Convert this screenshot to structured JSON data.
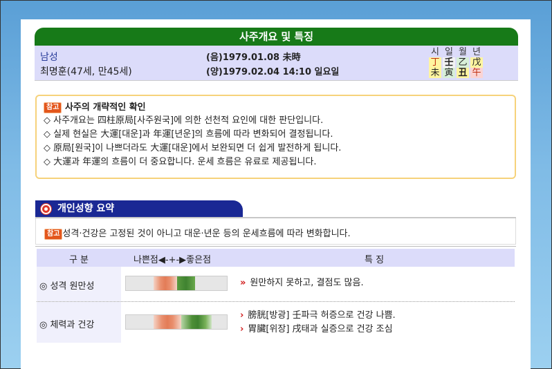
{
  "header": {
    "title": "사주개요 및 특징",
    "gender": "남성",
    "person": "최명훈(47세, 만45세)",
    "lunar_date": "(음)1979.01.08 未時",
    "solar_date": "(양)1979.02.04 14:10 일요일"
  },
  "pillars": [
    {
      "head": "시",
      "stem": "丁",
      "branch": "未",
      "stem_bg": "#fff5a0",
      "branch_bg": "#fff5a0"
    },
    {
      "head": "일",
      "stem": "壬",
      "branch": "寅",
      "stem_bg": "#f2f2f2",
      "branch_bg": "#d8f0d8"
    },
    {
      "head": "월",
      "stem": "乙",
      "branch": "丑",
      "stem_bg": "#d8f0d8",
      "branch_bg": "#fff5a0"
    },
    {
      "head": "년",
      "stem": "戊",
      "branch": "午",
      "stem_bg": "#fff5a0",
      "branch_bg": "#fad4d4"
    }
  ],
  "notice": {
    "badge": "참고",
    "heading": "사주의 개략적인 확인",
    "lines": [
      "◇ 사주개요는 四柱原局[사주원국]에 의한 선천적 요인에 대한 판단입니다.",
      "◇ 실제 현실은 大運[대운]과 年運[년운]의 흐름에 따라 변화되어 결정됩니다.",
      "◇ 原局[원국]이 나쁘더라도 大運[대운]에서 보완되면 더 쉽게 발전하게 됩니다.",
      "◇ 大運과 年運의 흐름이 더 중요합니다. 운세 흐름은 유료로 제공됩니다."
    ]
  },
  "section": {
    "title": "개인성향 요약",
    "remark_badge": "참고",
    "remark": "성격·건강은 고정된 것이 아니고 대운·년운 등의 운세흐름에 따라 변화합니다."
  },
  "table": {
    "headers": [
      "구 분",
      "나쁜점◀-+-▶좋은점",
      "특 징"
    ],
    "rows": [
      {
        "label": "◎ 성격 원만성",
        "arrow": "»",
        "lines": [
          "원만하지 못하고, 결점도 많음."
        ]
      },
      {
        "label": "◎ 체력과 건강",
        "arrow": "›",
        "lines": [
          "膀胱[방광] 壬파극 허증으로 건강 나쁨.",
          "胃臟[위장] 戌태과 실증으로 건강 조심"
        ]
      }
    ]
  }
}
